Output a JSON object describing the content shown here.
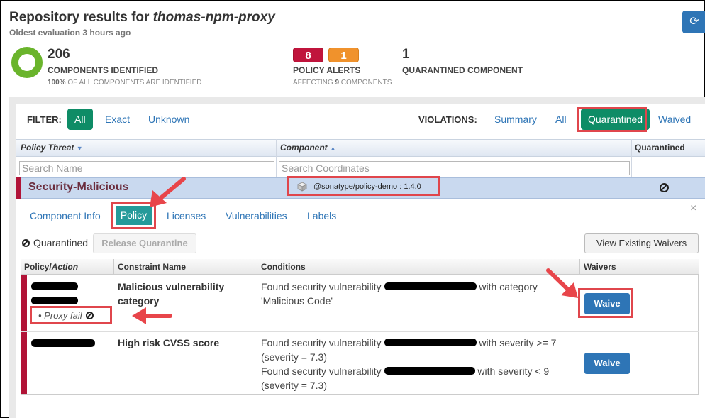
{
  "header": {
    "title_prefix": "Repository results for ",
    "title_repo": "thomas-npm-proxy",
    "subtitle": "Oldest evaluation 3 hours ago",
    "refresh_icon": "refresh-icon"
  },
  "stats": {
    "components_count": "206",
    "components_label": "COMPONENTS IDENTIFIED",
    "components_sub_pct": "100%",
    "components_sub_text": " OF ALL COMPONENTS ARE IDENTIFIED",
    "policy_critical": "8",
    "policy_severe": "1",
    "policy_label": "POLICY ALERTS",
    "policy_sub_prefix": "AFFECTING ",
    "policy_sub_count": "9",
    "policy_sub_suffix": " COMPONENTS",
    "quarantined_count": "1",
    "quarantined_label": "QUARANTINED COMPONENT",
    "colors": {
      "donut": "#6ab42c",
      "critical": "#c0143c",
      "severe": "#f0922c"
    }
  },
  "filter": {
    "label": "FILTER:",
    "options": [
      "All",
      "Exact",
      "Unknown"
    ],
    "active": "All"
  },
  "violations": {
    "label": "VIOLATIONS:",
    "options": [
      "Summary",
      "All",
      "Quarantined",
      "Waived"
    ],
    "active": "Quarantined"
  },
  "table": {
    "columns": [
      "Policy Threat",
      "Component",
      "Quarantined"
    ],
    "search_name_placeholder": "Search Name",
    "search_coords_placeholder": "Search Coordinates",
    "selected_row": {
      "threat": "Security-Malicious",
      "component": "@sonatype/policy-demo : 1.4.0"
    }
  },
  "detail": {
    "tabs": [
      "Component Info",
      "Policy",
      "Licenses",
      "Vulnerabilities",
      "Labels"
    ],
    "active_tab": "Policy",
    "close": "×",
    "status": "Quarantined",
    "release_button": "Release Quarantine",
    "view_waivers_button": "View Existing Waivers",
    "policy_columns": {
      "policy": "Policy/",
      "action": "Action",
      "constraint": "Constraint Name",
      "conditions": "Conditions",
      "waivers": "Waivers"
    },
    "rows": [
      {
        "constraint": "Malicious vulnerability category",
        "action": "Proxy fail",
        "conditions": [
          {
            "prefix": "Found security vulnerability ",
            "suffix": " with category 'Malicious Code'"
          }
        ],
        "waive": "Waive"
      },
      {
        "constraint": "High risk CVSS score",
        "conditions": [
          {
            "prefix": "Found security vulnerability ",
            "suffix": " with severity >= 7 (severity = 7.3)"
          },
          {
            "prefix": "Found security vulnerability ",
            "suffix": " with severity < 9 (severity = 7.3)"
          }
        ],
        "waive": "Waive"
      }
    ]
  }
}
